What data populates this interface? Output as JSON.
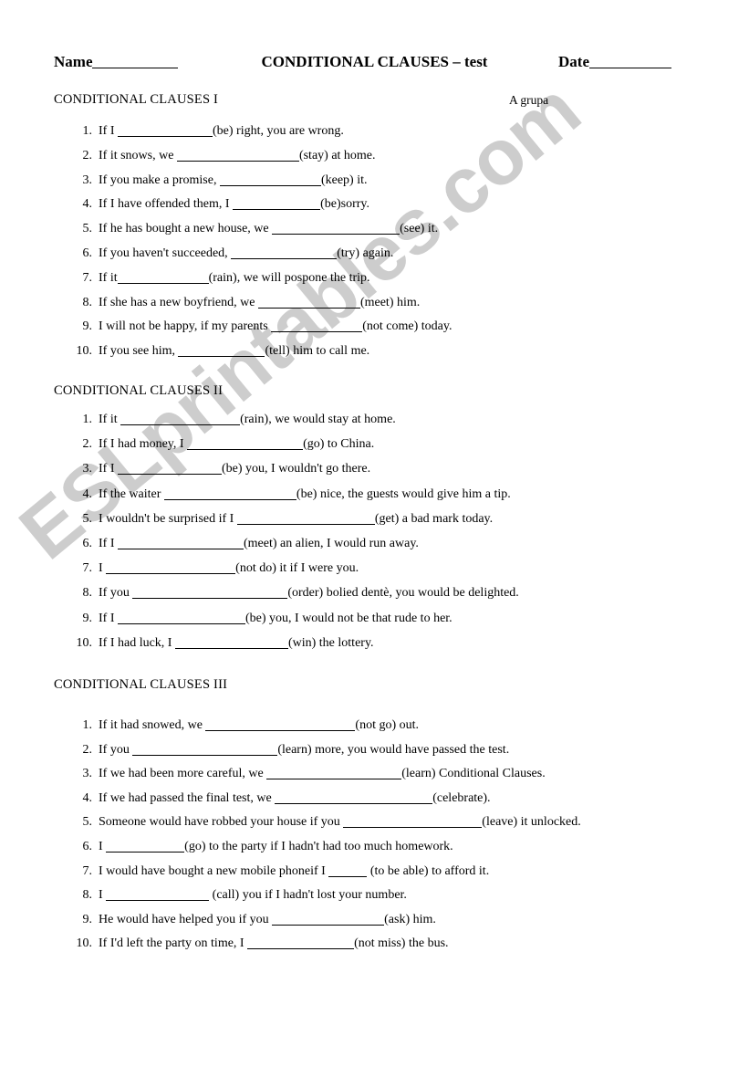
{
  "header": {
    "name_label": "Name",
    "title": "CONDITIONAL CLAUSES – test",
    "date_label": "Date",
    "group_label": "A grupa"
  },
  "watermark": {
    "text": "ESLprintables.com",
    "color": "#cdcdcd"
  },
  "sections": [
    {
      "heading": "CONDITIONAL CLAUSES I",
      "items": [
        {
          "num": "1.",
          "before": "If I ",
          "blank_width": 104,
          "after": "(be) right, you are wrong."
        },
        {
          "num": "2.",
          "before": "If it snows, we ",
          "blank_width": 134,
          "after": "(stay) at home."
        },
        {
          "num": "3.",
          "before": "If you make a promise, ",
          "blank_width": 111,
          "after": "(keep) it."
        },
        {
          "num": "4.",
          "before": "If I have offended them, I ",
          "blank_width": 96,
          "after": "(be)sorry."
        },
        {
          "num": "5.",
          "before": "If he has bought a new house, we ",
          "blank_width": 140,
          "after": "(see) it."
        },
        {
          "num": "6.",
          "before": "If you haven't succeeded, ",
          "blank_width": 116,
          "after": "(try) again."
        },
        {
          "num": "7.",
          "before": "If it",
          "blank_width": 100,
          "after": "(rain), we will pospone the trip."
        },
        {
          "num": "8.",
          "before": "If she has a new boyfriend, we ",
          "blank_width": 112,
          "after": "(meet) him."
        },
        {
          "num": "9.",
          "before": "I will not be happy, if my parents ",
          "blank_width": 100,
          "after": "(not come) today."
        },
        {
          "num": "10.",
          "before": "If you see him, ",
          "blank_width": 95,
          "after": "(tell) him to call me."
        }
      ]
    },
    {
      "heading": "CONDITIONAL CLAUSES II",
      "items": [
        {
          "num": "1.",
          "before": "If it ",
          "blank_width": 131,
          "after": "(rain), we would stay at home."
        },
        {
          "num": "2.",
          "before": "If I had money, I ",
          "blank_width": 127,
          "after": "(go) to China."
        },
        {
          "num": "3.",
          "before": "If I ",
          "blank_width": 114,
          "after": "(be) you, I wouldn't go there."
        },
        {
          "num": "4.",
          "before": "If the waiter ",
          "blank_width": 145,
          "after": "(be) nice, the guests would give him a tip."
        },
        {
          "num": "5.",
          "before": "I wouldn't be surprised if I ",
          "blank_width": 151,
          "after": "(get) a bad mark today."
        },
        {
          "num": "6.",
          "before": "If I ",
          "blank_width": 138,
          "after": "(meet) an alien, I would run away."
        },
        {
          "num": "7.",
          "before": "I ",
          "blank_width": 142,
          "after": "(not do) it if I were you."
        },
        {
          "num": "8.",
          "before": "If you ",
          "blank_width": 170,
          "after": "(order) bolied dentè, you would be delighted."
        },
        {
          "num": "9.",
          "before": "If I ",
          "blank_width": 140,
          "after": "(be) you, I would not be that rude to her."
        },
        {
          "num": "10.",
          "before": "If I had luck, I ",
          "blank_width": 124,
          "after": "(win) the lottery."
        }
      ]
    },
    {
      "heading": "CONDITIONAL CLAUSES III",
      "items": [
        {
          "num": "1.",
          "before": "If it had snowed, we ",
          "blank_width": 164,
          "after": "(not go) out."
        },
        {
          "num": "2.",
          "before": "If you ",
          "blank_width": 159,
          "after": "(learn) more, you would have passed the test."
        },
        {
          "num": "3.",
          "before": "If we had been more careful, we ",
          "blank_width": 148,
          "after": "(learn) Conditional Clauses."
        },
        {
          "num": "4.",
          "before": "If we had passed the final test, we ",
          "blank_width": 173,
          "after": "(celebrate)."
        },
        {
          "num": "5.",
          "before": "Someone would have robbed your house if you ",
          "blank_width": 152,
          "after": "(leave) it unlocked."
        },
        {
          "num": "6.",
          "before": "I ",
          "blank_width": 86,
          "after": "(go) to the party if I hadn't had too much homework."
        },
        {
          "num": "7.",
          "before": "I would have bought a new mobile phoneif I ",
          "blank_width": 42,
          "after": " (to be able) to afford it."
        },
        {
          "num": "8.",
          "before": "I ",
          "blank_width": 113,
          "after": " (call) you if I hadn't lost your number."
        },
        {
          "num": "9.",
          "before": "He would have helped you if you ",
          "blank_width": 123,
          "after": "(ask) him."
        },
        {
          "num": "10.",
          "before": "If I'd left the party on time, I ",
          "blank_width": 117,
          "after": "(not miss) the bus."
        }
      ]
    }
  ]
}
